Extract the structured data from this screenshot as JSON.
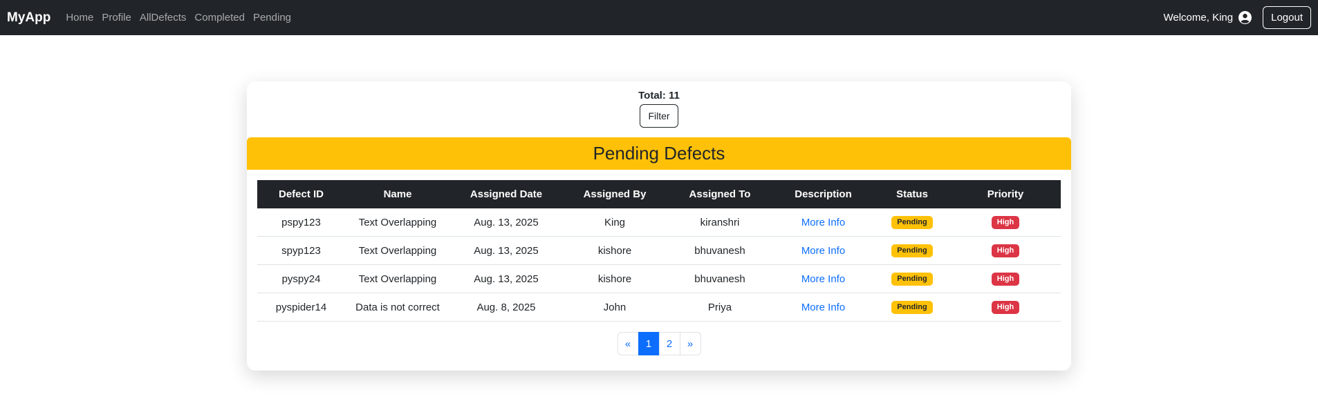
{
  "nav": {
    "brand": "MyApp",
    "links": [
      "Home",
      "Profile",
      "AllDefects",
      "Completed",
      "Pending"
    ],
    "welcome": "Welcome, King",
    "logout": "Logout",
    "user_icon": "user-circle-icon"
  },
  "summary": {
    "total": "Total: 11",
    "filter": "Filter"
  },
  "banner_title": "Pending Defects",
  "table": {
    "headers": [
      "Defect ID",
      "Name",
      "Assigned Date",
      "Assigned By",
      "Assigned To",
      "Description",
      "Status",
      "Priority"
    ],
    "rows": [
      {
        "id": "pspy123",
        "name": "Text Overlapping",
        "date": "Aug. 13, 2025",
        "by": "King",
        "to": "kiranshri",
        "desc": "More Info",
        "status": "Pending",
        "priority": "High"
      },
      {
        "id": "spyp123",
        "name": "Text Overlapping",
        "date": "Aug. 13, 2025",
        "by": "kishore",
        "to": "bhuvanesh",
        "desc": "More Info",
        "status": "Pending",
        "priority": "High"
      },
      {
        "id": "pyspy24",
        "name": "Text Overlapping",
        "date": "Aug. 13, 2025",
        "by": "kishore",
        "to": "bhuvanesh",
        "desc": "More Info",
        "status": "Pending",
        "priority": "High"
      },
      {
        "id": "pyspider14",
        "name": "Data is not correct",
        "date": "Aug. 8, 2025",
        "by": "John",
        "to": "Priya",
        "desc": "More Info",
        "status": "Pending",
        "priority": "High"
      }
    ]
  },
  "pagination": {
    "prev": "«",
    "pages": [
      "1",
      "2"
    ],
    "active": "1",
    "next": "»"
  },
  "colors": {
    "navbar": "#212529",
    "banner": "#ffc107",
    "link": "#0d6efd",
    "badge_pending": "#ffc107",
    "badge_high": "#dc3545"
  }
}
